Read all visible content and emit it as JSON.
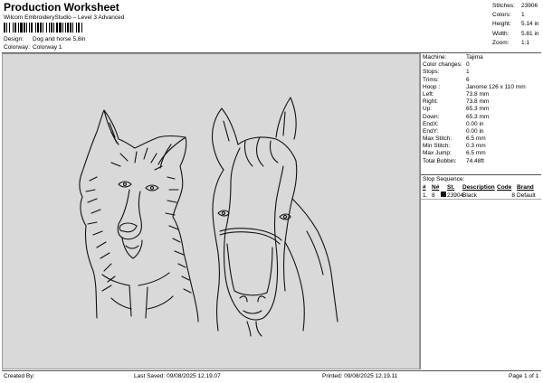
{
  "header": {
    "title": "Production Worksheet",
    "subtitle": "Wilcom EmbroideryStudio – Level 3 Advanced",
    "barcode_text": "|"
  },
  "meta": [
    {
      "label": "Design:",
      "value": "Dog and horse 5,8in"
    },
    {
      "label": "Colorway:",
      "value": "Colorway 1"
    }
  ],
  "stats": [
    {
      "label": "Stitches:",
      "value": "23906"
    },
    {
      "label": "Colors:",
      "value": "1"
    },
    {
      "label": "Height:",
      "value": "5.14 in"
    },
    {
      "label": "Width:",
      "value": "5.81 in"
    },
    {
      "label": "Zoom:",
      "value": "1:1"
    }
  ],
  "info": [
    {
      "label": "Machine:",
      "value": "Tajima"
    },
    {
      "label": "Color changes:",
      "value": "0"
    },
    {
      "label": "Stops:",
      "value": "1"
    },
    {
      "label": "Trims:",
      "value": "6"
    },
    {
      "label": "Hoop :",
      "value": "Janome 126 x 110 mm"
    },
    {
      "label": "Left:",
      "value": "73.8 mm"
    },
    {
      "label": "Right:",
      "value": "73.8 mm"
    },
    {
      "label": "Up:",
      "value": "65.3 mm"
    },
    {
      "label": "Down:",
      "value": "65.3 mm"
    },
    {
      "label": "EndX:",
      "value": "0.00 in"
    },
    {
      "label": "EndY:",
      "value": "0.00 in"
    },
    {
      "label": "Max Stitch:",
      "value": "6.5 mm"
    },
    {
      "label": "Min Stitch:",
      "value": "0.3 mm"
    },
    {
      "label": "Max Jump:",
      "value": "6.5 mm"
    },
    {
      "label": "Total Bobbin:",
      "value": "74.48ft"
    }
  ],
  "sequence": {
    "title": "Stop Sequence:",
    "headers": {
      "stop": "#",
      "n": "N#",
      "st": "St.",
      "desc": "Description",
      "code": "Code",
      "name": "Brand"
    },
    "rows": [
      {
        "stop": "1.",
        "n": "8",
        "color": "#111111",
        "st": "23904",
        "desc": "Black",
        "code": "8",
        "name": "Default"
      }
    ]
  },
  "footer": {
    "created": "Created By:",
    "saved": "Last Saved: 09/08/2025 12.19.07",
    "printed": "Printed: 09/08/2025 12.19.11",
    "page": "Page 1 of 1"
  },
  "artwork": {
    "subject": "dog-and-horse-outline",
    "stitch_color": "#111111",
    "background_color": "#d9d9d9"
  }
}
